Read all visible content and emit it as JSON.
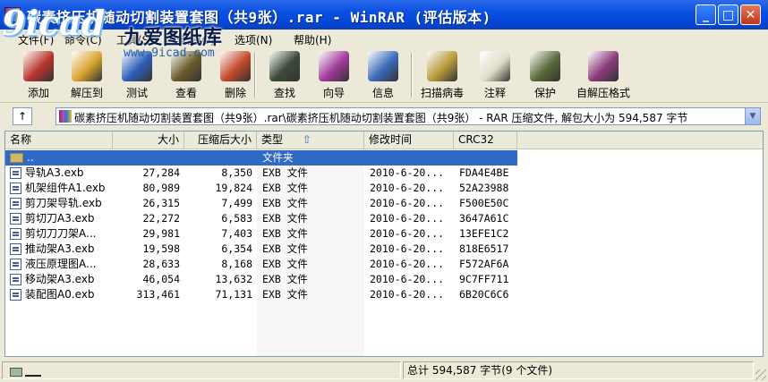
{
  "window": {
    "title": "碳素挤压机随动切割装置套图（共9张）.rar - WinRAR (评估版本)",
    "minimize": "_",
    "maximize": "□",
    "close": "✕"
  },
  "watermark": {
    "logo": "9icad",
    "chinese": "九爱图纸库",
    "url": "www.9icad.com"
  },
  "menu": [
    {
      "label": "文件(F)"
    },
    {
      "label": "命令(C)"
    },
    {
      "label": "工具(S)"
    },
    {
      "label": "收藏夹(O)"
    },
    {
      "label": "选项(N)"
    },
    {
      "label": "帮助(H)"
    }
  ],
  "toolbar": [
    {
      "label": "添加",
      "icon": "add-books-icon",
      "color": "#b8342e"
    },
    {
      "label": "解压到",
      "icon": "extract-folder-icon",
      "color": "#d9a532"
    },
    {
      "label": "测试",
      "icon": "test-check-icon",
      "color": "#2e5fb8"
    },
    {
      "label": "查看",
      "icon": "view-glasses-icon",
      "color": "#6a5a2a"
    },
    {
      "label": "删除",
      "icon": "delete-icon",
      "color": "#c24a2a"
    },
    {
      "label": "查找",
      "icon": "find-binoculars-icon",
      "color": "#3a4a3a"
    },
    {
      "label": "向导",
      "icon": "wizard-icon",
      "color": "#a03a9a"
    },
    {
      "label": "信息",
      "icon": "info-icon",
      "color": "#3a6ab8"
    },
    {
      "label": "扫描病毒",
      "icon": "scan-virus-icon",
      "color": "#b89a3a"
    },
    {
      "label": "注释",
      "icon": "comment-icon",
      "color": "#e0dcc8"
    },
    {
      "label": "保护",
      "icon": "protect-shield-icon",
      "color": "#5a6a3a"
    },
    {
      "label": "自解压格式",
      "icon": "sfx-icon",
      "color": "#8a3a7a"
    }
  ],
  "address": {
    "up_label": "↑",
    "path": "碳素挤压机随动切割装置套图（共9张）.rar\\碳素挤压机随动切割装置套图（共9张） - RAR 压缩文件, 解包大小为 594,587 字节",
    "dropdown": "▼"
  },
  "columns": {
    "name": "名称",
    "size": "大小",
    "packed": "压缩后大小",
    "type": "类型",
    "sort_indicator": "⇧",
    "modified": "修改时间",
    "crc": "CRC32"
  },
  "parent_row": {
    "name": "..",
    "type": "文件夹"
  },
  "files": [
    {
      "name": "导轨A3.exb",
      "size": "27,284",
      "packed": "8,350",
      "type": "EXB 文件",
      "modified": "2010-6-20...",
      "crc": "FDA4E4BE"
    },
    {
      "name": "机架组件A1.exb",
      "size": "80,989",
      "packed": "19,824",
      "type": "EXB 文件",
      "modified": "2010-6-20...",
      "crc": "52A23988"
    },
    {
      "name": "剪刀架导轨.exb",
      "size": "26,315",
      "packed": "7,499",
      "type": "EXB 文件",
      "modified": "2010-6-20...",
      "crc": "F500E50C"
    },
    {
      "name": "剪切刀A3.exb",
      "size": "22,272",
      "packed": "6,583",
      "type": "EXB 文件",
      "modified": "2010-6-20...",
      "crc": "3647A61C"
    },
    {
      "name": "剪切刀刀架A...",
      "size": "29,981",
      "packed": "7,403",
      "type": "EXB 文件",
      "modified": "2010-6-20...",
      "crc": "13EFE1C2"
    },
    {
      "name": "推动架A3.exb",
      "size": "19,598",
      "packed": "6,354",
      "type": "EXB 文件",
      "modified": "2010-6-20...",
      "crc": "818E6517"
    },
    {
      "name": "液压原理图A...",
      "size": "28,633",
      "packed": "8,168",
      "type": "EXB 文件",
      "modified": "2010-6-20...",
      "crc": "F572AF6A"
    },
    {
      "name": "移动架A3.exb",
      "size": "46,054",
      "packed": "13,632",
      "type": "EXB 文件",
      "modified": "2010-6-20...",
      "crc": "9C7FF711"
    },
    {
      "name": "装配图A0.exb",
      "size": "313,461",
      "packed": "71,131",
      "type": "EXB 文件",
      "modified": "2010-6-20...",
      "crc": "6B20C6C6"
    }
  ],
  "status": {
    "total": "总计 594,587 字节(9 个文件)"
  }
}
